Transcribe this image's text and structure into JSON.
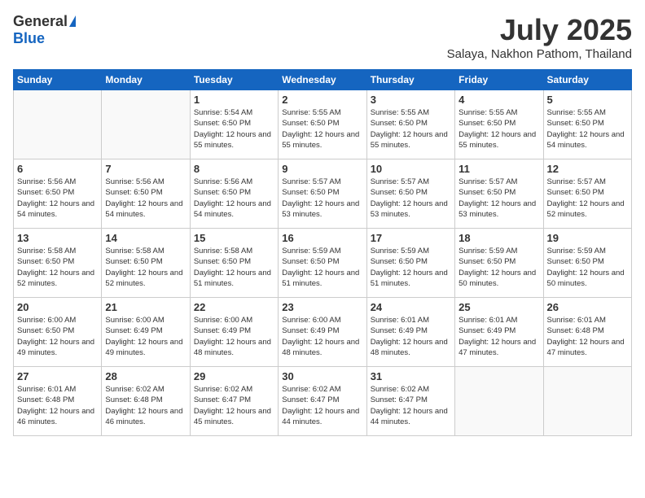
{
  "header": {
    "logo_general": "General",
    "logo_blue": "Blue",
    "month_title": "July 2025",
    "location": "Salaya, Nakhon Pathom, Thailand"
  },
  "weekdays": [
    "Sunday",
    "Monday",
    "Tuesday",
    "Wednesday",
    "Thursday",
    "Friday",
    "Saturday"
  ],
  "weeks": [
    [
      {
        "day": "",
        "sunrise": "",
        "sunset": "",
        "daylight": ""
      },
      {
        "day": "",
        "sunrise": "",
        "sunset": "",
        "daylight": ""
      },
      {
        "day": "1",
        "sunrise": "Sunrise: 5:54 AM",
        "sunset": "Sunset: 6:50 PM",
        "daylight": "Daylight: 12 hours and 55 minutes."
      },
      {
        "day": "2",
        "sunrise": "Sunrise: 5:55 AM",
        "sunset": "Sunset: 6:50 PM",
        "daylight": "Daylight: 12 hours and 55 minutes."
      },
      {
        "day": "3",
        "sunrise": "Sunrise: 5:55 AM",
        "sunset": "Sunset: 6:50 PM",
        "daylight": "Daylight: 12 hours and 55 minutes."
      },
      {
        "day": "4",
        "sunrise": "Sunrise: 5:55 AM",
        "sunset": "Sunset: 6:50 PM",
        "daylight": "Daylight: 12 hours and 55 minutes."
      },
      {
        "day": "5",
        "sunrise": "Sunrise: 5:55 AM",
        "sunset": "Sunset: 6:50 PM",
        "daylight": "Daylight: 12 hours and 54 minutes."
      }
    ],
    [
      {
        "day": "6",
        "sunrise": "Sunrise: 5:56 AM",
        "sunset": "Sunset: 6:50 PM",
        "daylight": "Daylight: 12 hours and 54 minutes."
      },
      {
        "day": "7",
        "sunrise": "Sunrise: 5:56 AM",
        "sunset": "Sunset: 6:50 PM",
        "daylight": "Daylight: 12 hours and 54 minutes."
      },
      {
        "day": "8",
        "sunrise": "Sunrise: 5:56 AM",
        "sunset": "Sunset: 6:50 PM",
        "daylight": "Daylight: 12 hours and 54 minutes."
      },
      {
        "day": "9",
        "sunrise": "Sunrise: 5:57 AM",
        "sunset": "Sunset: 6:50 PM",
        "daylight": "Daylight: 12 hours and 53 minutes."
      },
      {
        "day": "10",
        "sunrise": "Sunrise: 5:57 AM",
        "sunset": "Sunset: 6:50 PM",
        "daylight": "Daylight: 12 hours and 53 minutes."
      },
      {
        "day": "11",
        "sunrise": "Sunrise: 5:57 AM",
        "sunset": "Sunset: 6:50 PM",
        "daylight": "Daylight: 12 hours and 53 minutes."
      },
      {
        "day": "12",
        "sunrise": "Sunrise: 5:57 AM",
        "sunset": "Sunset: 6:50 PM",
        "daylight": "Daylight: 12 hours and 52 minutes."
      }
    ],
    [
      {
        "day": "13",
        "sunrise": "Sunrise: 5:58 AM",
        "sunset": "Sunset: 6:50 PM",
        "daylight": "Daylight: 12 hours and 52 minutes."
      },
      {
        "day": "14",
        "sunrise": "Sunrise: 5:58 AM",
        "sunset": "Sunset: 6:50 PM",
        "daylight": "Daylight: 12 hours and 52 minutes."
      },
      {
        "day": "15",
        "sunrise": "Sunrise: 5:58 AM",
        "sunset": "Sunset: 6:50 PM",
        "daylight": "Daylight: 12 hours and 51 minutes."
      },
      {
        "day": "16",
        "sunrise": "Sunrise: 5:59 AM",
        "sunset": "Sunset: 6:50 PM",
        "daylight": "Daylight: 12 hours and 51 minutes."
      },
      {
        "day": "17",
        "sunrise": "Sunrise: 5:59 AM",
        "sunset": "Sunset: 6:50 PM",
        "daylight": "Daylight: 12 hours and 51 minutes."
      },
      {
        "day": "18",
        "sunrise": "Sunrise: 5:59 AM",
        "sunset": "Sunset: 6:50 PM",
        "daylight": "Daylight: 12 hours and 50 minutes."
      },
      {
        "day": "19",
        "sunrise": "Sunrise: 5:59 AM",
        "sunset": "Sunset: 6:50 PM",
        "daylight": "Daylight: 12 hours and 50 minutes."
      }
    ],
    [
      {
        "day": "20",
        "sunrise": "Sunrise: 6:00 AM",
        "sunset": "Sunset: 6:50 PM",
        "daylight": "Daylight: 12 hours and 49 minutes."
      },
      {
        "day": "21",
        "sunrise": "Sunrise: 6:00 AM",
        "sunset": "Sunset: 6:49 PM",
        "daylight": "Daylight: 12 hours and 49 minutes."
      },
      {
        "day": "22",
        "sunrise": "Sunrise: 6:00 AM",
        "sunset": "Sunset: 6:49 PM",
        "daylight": "Daylight: 12 hours and 48 minutes."
      },
      {
        "day": "23",
        "sunrise": "Sunrise: 6:00 AM",
        "sunset": "Sunset: 6:49 PM",
        "daylight": "Daylight: 12 hours and 48 minutes."
      },
      {
        "day": "24",
        "sunrise": "Sunrise: 6:01 AM",
        "sunset": "Sunset: 6:49 PM",
        "daylight": "Daylight: 12 hours and 48 minutes."
      },
      {
        "day": "25",
        "sunrise": "Sunrise: 6:01 AM",
        "sunset": "Sunset: 6:49 PM",
        "daylight": "Daylight: 12 hours and 47 minutes."
      },
      {
        "day": "26",
        "sunrise": "Sunrise: 6:01 AM",
        "sunset": "Sunset: 6:48 PM",
        "daylight": "Daylight: 12 hours and 47 minutes."
      }
    ],
    [
      {
        "day": "27",
        "sunrise": "Sunrise: 6:01 AM",
        "sunset": "Sunset: 6:48 PM",
        "daylight": "Daylight: 12 hours and 46 minutes."
      },
      {
        "day": "28",
        "sunrise": "Sunrise: 6:02 AM",
        "sunset": "Sunset: 6:48 PM",
        "daylight": "Daylight: 12 hours and 46 minutes."
      },
      {
        "day": "29",
        "sunrise": "Sunrise: 6:02 AM",
        "sunset": "Sunset: 6:47 PM",
        "daylight": "Daylight: 12 hours and 45 minutes."
      },
      {
        "day": "30",
        "sunrise": "Sunrise: 6:02 AM",
        "sunset": "Sunset: 6:47 PM",
        "daylight": "Daylight: 12 hours and 44 minutes."
      },
      {
        "day": "31",
        "sunrise": "Sunrise: 6:02 AM",
        "sunset": "Sunset: 6:47 PM",
        "daylight": "Daylight: 12 hours and 44 minutes."
      },
      {
        "day": "",
        "sunrise": "",
        "sunset": "",
        "daylight": ""
      },
      {
        "day": "",
        "sunrise": "",
        "sunset": "",
        "daylight": ""
      }
    ]
  ]
}
